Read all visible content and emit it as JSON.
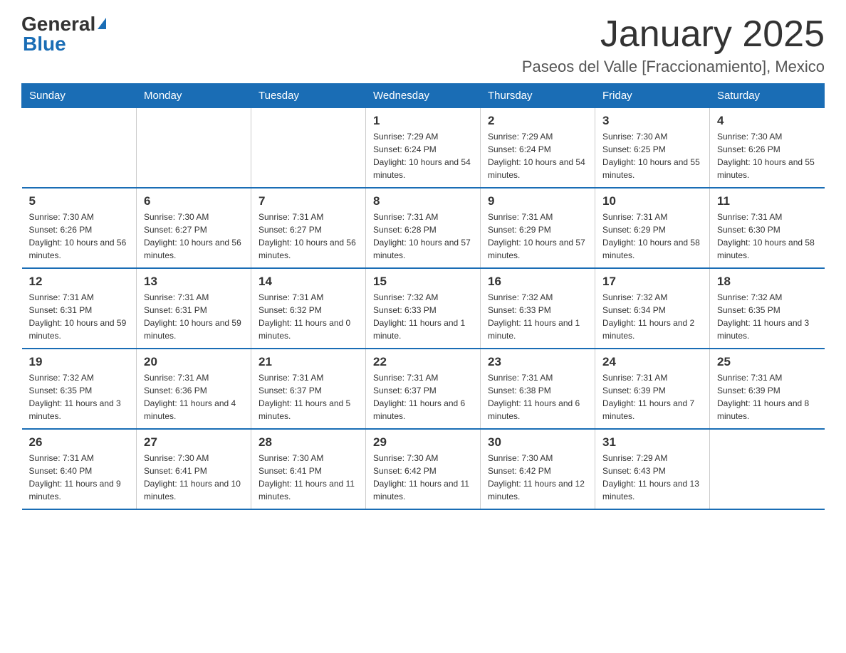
{
  "logo": {
    "text_general": "General",
    "text_blue": "Blue"
  },
  "header": {
    "title": "January 2025",
    "subtitle": "Paseos del Valle [Fraccionamiento], Mexico"
  },
  "days_of_week": [
    "Sunday",
    "Monday",
    "Tuesday",
    "Wednesday",
    "Thursday",
    "Friday",
    "Saturday"
  ],
  "weeks": [
    [
      {
        "day": "",
        "info": ""
      },
      {
        "day": "",
        "info": ""
      },
      {
        "day": "",
        "info": ""
      },
      {
        "day": "1",
        "info": "Sunrise: 7:29 AM\nSunset: 6:24 PM\nDaylight: 10 hours and 54 minutes."
      },
      {
        "day": "2",
        "info": "Sunrise: 7:29 AM\nSunset: 6:24 PM\nDaylight: 10 hours and 54 minutes."
      },
      {
        "day": "3",
        "info": "Sunrise: 7:30 AM\nSunset: 6:25 PM\nDaylight: 10 hours and 55 minutes."
      },
      {
        "day": "4",
        "info": "Sunrise: 7:30 AM\nSunset: 6:26 PM\nDaylight: 10 hours and 55 minutes."
      }
    ],
    [
      {
        "day": "5",
        "info": "Sunrise: 7:30 AM\nSunset: 6:26 PM\nDaylight: 10 hours and 56 minutes."
      },
      {
        "day": "6",
        "info": "Sunrise: 7:30 AM\nSunset: 6:27 PM\nDaylight: 10 hours and 56 minutes."
      },
      {
        "day": "7",
        "info": "Sunrise: 7:31 AM\nSunset: 6:27 PM\nDaylight: 10 hours and 56 minutes."
      },
      {
        "day": "8",
        "info": "Sunrise: 7:31 AM\nSunset: 6:28 PM\nDaylight: 10 hours and 57 minutes."
      },
      {
        "day": "9",
        "info": "Sunrise: 7:31 AM\nSunset: 6:29 PM\nDaylight: 10 hours and 57 minutes."
      },
      {
        "day": "10",
        "info": "Sunrise: 7:31 AM\nSunset: 6:29 PM\nDaylight: 10 hours and 58 minutes."
      },
      {
        "day": "11",
        "info": "Sunrise: 7:31 AM\nSunset: 6:30 PM\nDaylight: 10 hours and 58 minutes."
      }
    ],
    [
      {
        "day": "12",
        "info": "Sunrise: 7:31 AM\nSunset: 6:31 PM\nDaylight: 10 hours and 59 minutes."
      },
      {
        "day": "13",
        "info": "Sunrise: 7:31 AM\nSunset: 6:31 PM\nDaylight: 10 hours and 59 minutes."
      },
      {
        "day": "14",
        "info": "Sunrise: 7:31 AM\nSunset: 6:32 PM\nDaylight: 11 hours and 0 minutes."
      },
      {
        "day": "15",
        "info": "Sunrise: 7:32 AM\nSunset: 6:33 PM\nDaylight: 11 hours and 1 minute."
      },
      {
        "day": "16",
        "info": "Sunrise: 7:32 AM\nSunset: 6:33 PM\nDaylight: 11 hours and 1 minute."
      },
      {
        "day": "17",
        "info": "Sunrise: 7:32 AM\nSunset: 6:34 PM\nDaylight: 11 hours and 2 minutes."
      },
      {
        "day": "18",
        "info": "Sunrise: 7:32 AM\nSunset: 6:35 PM\nDaylight: 11 hours and 3 minutes."
      }
    ],
    [
      {
        "day": "19",
        "info": "Sunrise: 7:32 AM\nSunset: 6:35 PM\nDaylight: 11 hours and 3 minutes."
      },
      {
        "day": "20",
        "info": "Sunrise: 7:31 AM\nSunset: 6:36 PM\nDaylight: 11 hours and 4 minutes."
      },
      {
        "day": "21",
        "info": "Sunrise: 7:31 AM\nSunset: 6:37 PM\nDaylight: 11 hours and 5 minutes."
      },
      {
        "day": "22",
        "info": "Sunrise: 7:31 AM\nSunset: 6:37 PM\nDaylight: 11 hours and 6 minutes."
      },
      {
        "day": "23",
        "info": "Sunrise: 7:31 AM\nSunset: 6:38 PM\nDaylight: 11 hours and 6 minutes."
      },
      {
        "day": "24",
        "info": "Sunrise: 7:31 AM\nSunset: 6:39 PM\nDaylight: 11 hours and 7 minutes."
      },
      {
        "day": "25",
        "info": "Sunrise: 7:31 AM\nSunset: 6:39 PM\nDaylight: 11 hours and 8 minutes."
      }
    ],
    [
      {
        "day": "26",
        "info": "Sunrise: 7:31 AM\nSunset: 6:40 PM\nDaylight: 11 hours and 9 minutes."
      },
      {
        "day": "27",
        "info": "Sunrise: 7:30 AM\nSunset: 6:41 PM\nDaylight: 11 hours and 10 minutes."
      },
      {
        "day": "28",
        "info": "Sunrise: 7:30 AM\nSunset: 6:41 PM\nDaylight: 11 hours and 11 minutes."
      },
      {
        "day": "29",
        "info": "Sunrise: 7:30 AM\nSunset: 6:42 PM\nDaylight: 11 hours and 11 minutes."
      },
      {
        "day": "30",
        "info": "Sunrise: 7:30 AM\nSunset: 6:42 PM\nDaylight: 11 hours and 12 minutes."
      },
      {
        "day": "31",
        "info": "Sunrise: 7:29 AM\nSunset: 6:43 PM\nDaylight: 11 hours and 13 minutes."
      },
      {
        "day": "",
        "info": ""
      }
    ]
  ]
}
